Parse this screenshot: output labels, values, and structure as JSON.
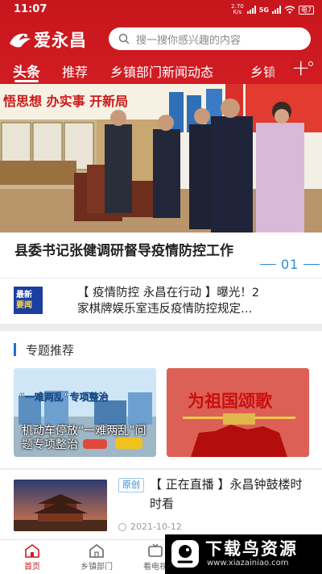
{
  "status_bar": {
    "time": "11:07",
    "net_speed_value": "2.70",
    "net_speed_unit": "K/s",
    "network": "5G",
    "battery": "电7"
  },
  "header": {
    "app_name": "爱永昌",
    "search": {
      "placeholder": "搜一搜你感兴趣的内容"
    },
    "tabs": [
      {
        "label": "头条",
        "active": true
      },
      {
        "label": "推荐"
      },
      {
        "label": "乡镇部门新闻动态"
      },
      {
        "label": "乡镇"
      }
    ],
    "add_tab_symbol": "+"
  },
  "hero": {
    "banner_text": "悟思想 办实事 开新局",
    "title": "县委书记张健调研督导疫情防控工作",
    "index": "01"
  },
  "breaking": {
    "badge_line1": "最新",
    "badge_line2": "要闻",
    "text_line1": "【 疫情防控  永昌在行动 】曝光！2",
    "text_line2": "家棋牌娱乐室违反疫情防控规定…"
  },
  "featured": {
    "section_title": "专题推荐",
    "cards": [
      {
        "headline": "“一难两乱”专项整治",
        "caption": "机动车停放“一难两乱”问题专项整治"
      },
      {
        "headline": "为祖国颂歌"
      }
    ]
  },
  "news": {
    "tag": "原创",
    "title": "【 正在直播 】永昌钟鼓楼时时看",
    "date": "2021-10-12"
  },
  "bottom_nav": {
    "items": [
      {
        "label": "首页",
        "active": true
      },
      {
        "label": "乡镇部门"
      },
      {
        "label": "看电视"
      }
    ]
  },
  "watermark": {
    "title": "下载鸟资源",
    "url": "www.xiazainiao.com"
  },
  "colors": {
    "brand_red": "#d01c22",
    "accent_blue": "#2b8ad8",
    "badge_blue": "#1b3fa0"
  }
}
